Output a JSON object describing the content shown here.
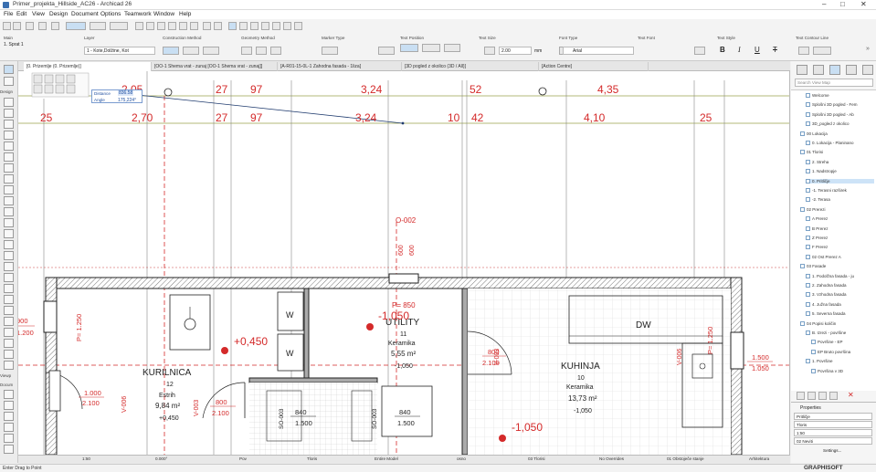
{
  "window": {
    "title": "Primer_projekta_Hillside_AC26 - Archicad 26"
  },
  "menu": [
    "File",
    "Edit",
    "View",
    "Design",
    "Document",
    "Options",
    "Teamwork",
    "Window",
    "Help"
  ],
  "infobox": {
    "groups": [
      "Main",
      "Layer",
      "Construction Method",
      "Geometry Method",
      "Marker Type",
      "Text Position",
      "Text Size",
      "Font Type",
      "Text Font",
      "Text Style",
      "Text Contour Line"
    ],
    "story": "1. Sprat 1",
    "layer": "1 - Kote,Dolžine, Kot",
    "font_size_value": "2.00",
    "font_size_unit": "mm",
    "font": "Arial"
  },
  "tabs": [
    {
      "label": "[0. Prizemlje (0. Prizemlje)]",
      "active": true
    },
    {
      "label": "[OO-1 Shema vrat - zunaj [OO-1 Shema vrat - zunaj]]",
      "active": false
    },
    {
      "label": "[A-R01-15-0L-1 Zahodna fasada - 1liza]",
      "active": false
    },
    {
      "label": "[3D pogled z okolico (3D / All)]",
      "active": false
    },
    {
      "label": "[Action Centre]",
      "active": false
    }
  ],
  "toolbox_labels": [
    "Design",
    "Docum",
    "Viewp"
  ],
  "tracker": {
    "distance_label": "Distance",
    "distance_value": "836.58",
    "angle_label": "Angle",
    "angle_value": "175,224°"
  },
  "drawing": {
    "top_dims": [
      "2,05",
      "27",
      "97",
      "3,24",
      "52",
      "4,35"
    ],
    "mid_dims": [
      "25",
      "2,70",
      "27",
      "97",
      "3,24",
      "10",
      "42",
      "4,10",
      "25"
    ],
    "door_tag": "O-002",
    "door_tag_dims": [
      "600",
      "600"
    ],
    "door_parapet": "P= 850",
    "rooms": [
      {
        "name": "UTILITY",
        "num": "11",
        "mat": "Keramika",
        "area": "5,55 m²",
        "level": "-1,050"
      },
      {
        "name": "KURILNICA",
        "num": "12",
        "mat": "Estrih",
        "area": "9,84 m²",
        "level": "+0,450"
      },
      {
        "name": "KUHINJA",
        "num": "10",
        "mat": "Keramika",
        "area": "13,73 m²",
        "level": "-1,050"
      }
    ],
    "level_marks": [
      "-1,050",
      "+0,450",
      "-1,050"
    ],
    "dw_label": "DW",
    "w_labels": [
      "W",
      "W"
    ],
    "door_dims": [
      "800",
      "2.100",
      "800",
      "2.100",
      "1.000",
      "2.100"
    ],
    "window_dims": [
      "1.500",
      "1.050",
      "840",
      "1.500",
      "840",
      "1.500"
    ],
    "side_labels": [
      "P= 1.250",
      "P= 1.250"
    ],
    "side_left": [
      "900",
      "1.200"
    ],
    "vertical_tags": [
      "V-006",
      "V-003",
      "V-003",
      "V-006",
      "SO-003",
      "SO-003"
    ]
  },
  "navigator": {
    "search_placeholder": "Search View Map",
    "items": [
      {
        "label": "Welcome",
        "indent": 2,
        "sel": false
      },
      {
        "label": "Splošni 3D pogled - Fem",
        "indent": 2,
        "sel": false
      },
      {
        "label": "Splošni 3D pogled - Ab",
        "indent": 2,
        "sel": false
      },
      {
        "label": "3D_pogled z okolico",
        "indent": 2,
        "sel": false
      },
      {
        "label": "00 Lokacija",
        "indent": 1,
        "sel": false
      },
      {
        "label": "0. Lokacija - Planinano",
        "indent": 2,
        "sel": false
      },
      {
        "label": "01 Tlorisi",
        "indent": 1,
        "sel": false
      },
      {
        "label": "2. Streha",
        "indent": 2,
        "sel": false
      },
      {
        "label": "1. Nadstropje",
        "indent": 2,
        "sel": false
      },
      {
        "label": "0. Pritličje",
        "indent": 2,
        "sel": true
      },
      {
        "label": "-1. Terasni razširek",
        "indent": 2,
        "sel": false
      },
      {
        "label": "-2. Terasa",
        "indent": 2,
        "sel": false
      },
      {
        "label": "02 Prerezi",
        "indent": 1,
        "sel": false
      },
      {
        "label": "A Prerez",
        "indent": 2,
        "sel": false
      },
      {
        "label": "B Prerez",
        "indent": 2,
        "sel": false
      },
      {
        "label": "Z Prerez",
        "indent": 2,
        "sel": false
      },
      {
        "label": "F Prerez",
        "indent": 2,
        "sel": false
      },
      {
        "label": "02 Ost Prerez A",
        "indent": 2,
        "sel": false
      },
      {
        "label": "03 Fasade",
        "indent": 1,
        "sel": false
      },
      {
        "label": "1. Podolžna fasada - ju",
        "indent": 2,
        "sel": false
      },
      {
        "label": "2. Zahodna fasada",
        "indent": 2,
        "sel": false
      },
      {
        "label": "3. Vzhodna fasada",
        "indent": 2,
        "sel": false
      },
      {
        "label": "4. Južna fasada",
        "indent": 2,
        "sel": false
      },
      {
        "label": "5. Severna fasada",
        "indent": 2,
        "sel": false
      },
      {
        "label": "04 Popisi količin",
        "indent": 1,
        "sel": false
      },
      {
        "label": "B. Izrezi - površine",
        "indent": 2,
        "sel": false
      },
      {
        "label": "Površine - EP",
        "indent": 3,
        "sel": false
      },
      {
        "label": "EP Bruto površina",
        "indent": 3,
        "sel": false
      },
      {
        "label": "1. Površine",
        "indent": 2,
        "sel": false
      },
      {
        "label": "Površina v 3D",
        "indent": 3,
        "sel": false
      }
    ]
  },
  "properties": {
    "title": "Properties",
    "rows": [
      "Pritličje",
      "Tloris",
      "1:50",
      "02 Neviti"
    ],
    "settings": "Settings..."
  },
  "brand": "GRAPHISOFT",
  "status": {
    "left": "Enter Drag to Point",
    "items": [
      "1:50",
      "0.000°",
      "Pov",
      "Tloris",
      "Entire Model",
      "osno",
      "03 Tlorisi",
      "No Overrides",
      "01 Obstoječe stanje",
      "Arhitektura"
    ]
  }
}
